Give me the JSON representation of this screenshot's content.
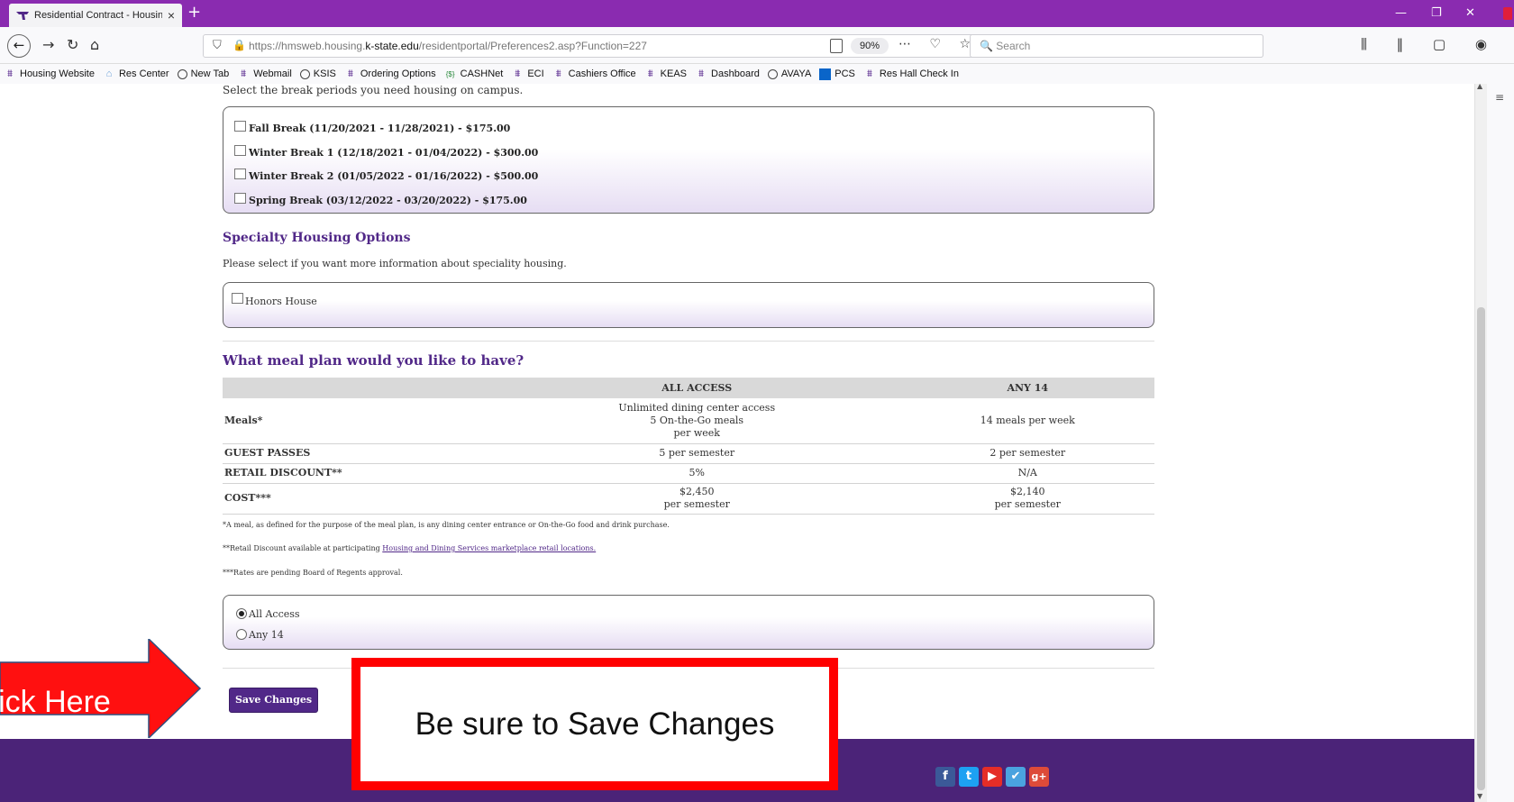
{
  "browser": {
    "tab_title": "Residential Contract - Housing",
    "new_tab": "+",
    "url_prefix": "https://hmsweb.housing.",
    "url_domain": "k-state.edu",
    "url_path": "/residentportal/Preferences2.asp?Function=227",
    "zoom": "90%",
    "search_placeholder": "Search"
  },
  "bookmarks": [
    {
      "label": "Housing Website",
      "icon": "ksu-wildcat-icon"
    },
    {
      "label": "Res Center",
      "icon": "home-icon"
    },
    {
      "label": "New Tab",
      "icon": "globe-icon"
    },
    {
      "label": "Webmail",
      "icon": "ksu-wildcat-icon"
    },
    {
      "label": "KSIS",
      "icon": "globe-icon"
    },
    {
      "label": "Ordering Options",
      "icon": "ksu-wildcat-icon"
    },
    {
      "label": "CASHNet",
      "icon": "cashnet-icon"
    },
    {
      "label": "ECI",
      "icon": "ksu-wildcat-icon"
    },
    {
      "label": "Cashiers Office",
      "icon": "ksu-wildcat-icon"
    },
    {
      "label": "KEAS",
      "icon": "ksu-wildcat-icon"
    },
    {
      "label": "Dashboard",
      "icon": "ksu-wildcat-icon"
    },
    {
      "label": "AVAYA",
      "icon": "globe-icon"
    },
    {
      "label": "PCS",
      "icon": "pcs-icon"
    },
    {
      "label": "Res Hall Check In",
      "icon": "ksu-wildcat-icon"
    }
  ],
  "breaks": {
    "intro": "Select the break periods you need housing on campus.",
    "items": [
      "Fall Break (11/20/2021 - 11/28/2021) - $175.00",
      "Winter Break 1 (12/18/2021 - 01/04/2022) - $300.00",
      "Winter Break 2 (01/05/2022 - 01/16/2022) - $500.00",
      "Spring Break (03/12/2022 - 03/20/2022) - $175.00"
    ]
  },
  "specialty": {
    "title": "Specialty Housing Options",
    "description": "Please select if you want more information about speciality housing.",
    "option": "Honors House"
  },
  "meal_plan": {
    "title": "What meal plan would you like to have?",
    "columns": [
      "",
      "ALL ACCESS",
      "ANY 14"
    ],
    "rows": [
      {
        "label": "Meals*",
        "all_access": "Unlimited dining center access\n5 On-the-Go meals\nper week",
        "any14": "14 meals per week"
      },
      {
        "label": "GUEST PASSES",
        "all_access": "5 per semester",
        "any14": "2 per semester"
      },
      {
        "label": "RETAIL DISCOUNT**",
        "all_access": "5%",
        "any14": "N/A"
      },
      {
        "label": "COST***",
        "all_access": "$2,450\nper semester",
        "any14": "$2,140\nper semester"
      }
    ],
    "note1": "*A meal, as defined for the purpose of the meal plan, is any dining center entrance or On-the-Go food and drink purchase.",
    "note2_prefix": "**Retail Discount available at participating ",
    "note2_link": "Housing and Dining Services marketplace retail locations.",
    "note3": "***Rates are pending Board of Regents approval.",
    "options": [
      "All Access",
      "Any 14"
    ],
    "selected": "All Access"
  },
  "save_button": "Save Changes",
  "annotations": {
    "arrow_text": "Click Here",
    "callout_text": "Be sure to Save Changes",
    "color": "#ff0000"
  },
  "colors": {
    "brand_purple": "#512888",
    "browser_purple": "#8a2bb0",
    "footer_purple": "#4b2378"
  },
  "social": [
    {
      "icon": "facebook-icon",
      "glyph": "f",
      "color": "#3b5998"
    },
    {
      "icon": "twitter-icon",
      "glyph": "t",
      "color": "#1da1f2"
    },
    {
      "icon": "youtube-icon",
      "glyph": "▶",
      "color": "#e52d27"
    },
    {
      "icon": "checkmark-icon",
      "glyph": "✔",
      "color": "#4aa3df"
    },
    {
      "icon": "google-plus-icon",
      "glyph": "g+",
      "color": "#dd4b39"
    }
  ]
}
